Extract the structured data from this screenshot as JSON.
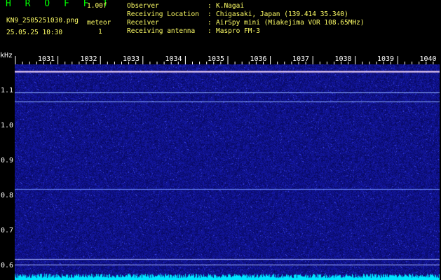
{
  "header": {
    "title": "H R O F F T",
    "version": "1.00f",
    "filename": "KN9_2505251030.png",
    "datetime": "25.05.25 10:30",
    "meteor_label": "meteor",
    "meteor_count": "1"
  },
  "meta": [
    {
      "label": "Observer",
      "value": "K.Nagai"
    },
    {
      "label": "Receiving Location",
      "value": "Chigasaki, Japan (139.414 35.340)"
    },
    {
      "label": "Receiver",
      "value": "AirSpy mini (Miakejima VOR 108.65MHz)"
    },
    {
      "label": "Receiving antenna",
      "value": "Maspro FM-3"
    }
  ],
  "separator": ":",
  "axis": {
    "unit": "kHz",
    "x_ticks": [
      "1031",
      "1032",
      "1033",
      "1034",
      "1035",
      "1036",
      "1037",
      "1038",
      "1039",
      "1040"
    ],
    "y_ticks": [
      "1.1",
      "1.0",
      "0.9",
      "0.8",
      "0.7",
      "0.6"
    ]
  },
  "colors": {
    "background": "#000000",
    "waterfall": "#0a0a6e",
    "noise_low": "#1a1aa0",
    "noise_high": "#4d6bff",
    "carrier": "#c0c0ff",
    "baseline": "#00e5ff"
  }
}
